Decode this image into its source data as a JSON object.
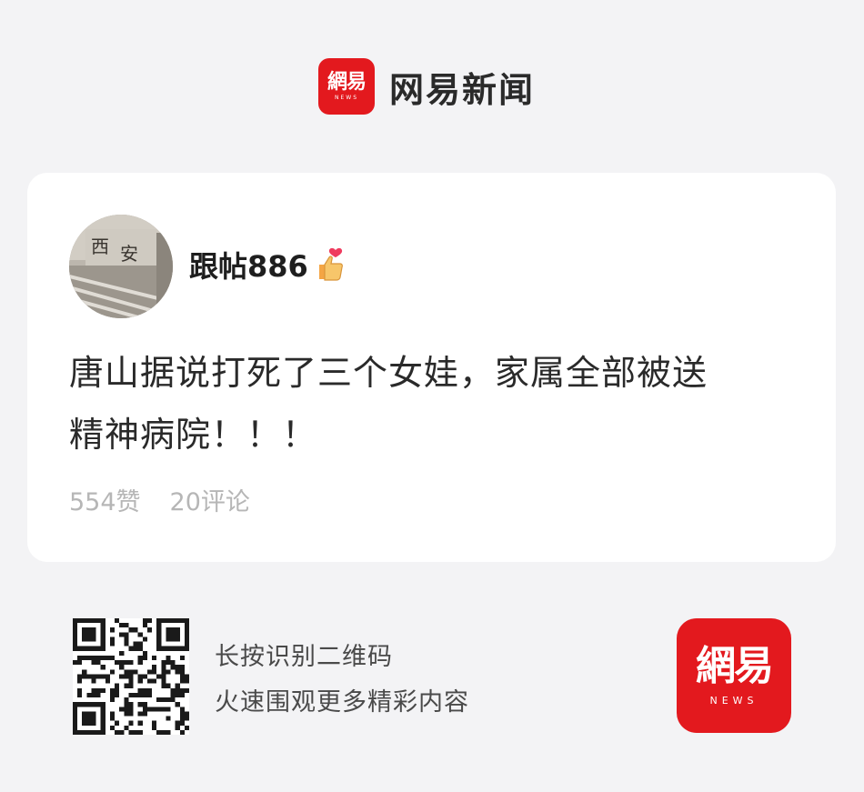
{
  "header": {
    "logo_text": "網易",
    "logo_subtext": "NEWS",
    "app_name": "网易新闻"
  },
  "post": {
    "username": "跟帖886",
    "badge_icon": "thumbs-up-heart-icon",
    "content_line1": "唐山据说打死了三个女娃，家属全部被送",
    "content_line2": "精神病院！！！",
    "likes": "554赞",
    "comments": "20评论"
  },
  "footer": {
    "line1": "长按识别二维码",
    "line2": "火速围观更多精彩内容",
    "logo_text": "網易",
    "logo_subtext": "NEWS"
  },
  "colors": {
    "brand_red": "#e3191e",
    "page_bg": "#f3f3f5",
    "card_bg": "#ffffff",
    "muted_text": "#b6b6b6"
  }
}
